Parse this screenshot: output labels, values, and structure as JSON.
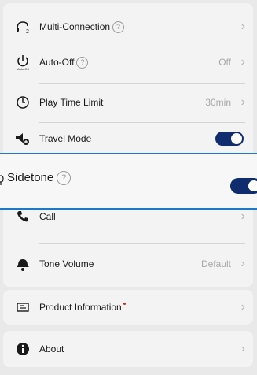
{
  "settings": {
    "multi_connection": {
      "label": "Multi-Connection",
      "help": "?"
    },
    "auto_off": {
      "label": "Auto-Off",
      "help": "?",
      "value": "Off",
      "icon_caption": "Auto-Off"
    },
    "play_time_limit": {
      "label": "Play Time Limit",
      "value": "30min"
    },
    "travel_mode": {
      "label": "Travel Mode",
      "enabled": true
    },
    "sidetone": {
      "label": "Sidetone",
      "help": "?",
      "enabled": true
    },
    "call": {
      "label": "Call"
    },
    "tone_volume": {
      "label": "Tone Volume",
      "value": "Default"
    }
  },
  "product_information": {
    "label": "Product Information"
  },
  "about": {
    "label": "About"
  },
  "icons": {
    "multi_connection": "headphone-multi-icon",
    "auto_off": "power-icon",
    "play_time_limit": "clock-icon",
    "travel_mode": "speaker-plus-icon",
    "sidetone": "mic-icon",
    "call": "phone-icon",
    "tone_volume": "bell-person-icon",
    "product_information": "info-card-icon",
    "about": "info-icon",
    "chevron": "chevron-right-icon"
  },
  "colors": {
    "toggle_on": "#0e2c6e",
    "highlight": "#1f78c8",
    "badge": "#e02020"
  }
}
